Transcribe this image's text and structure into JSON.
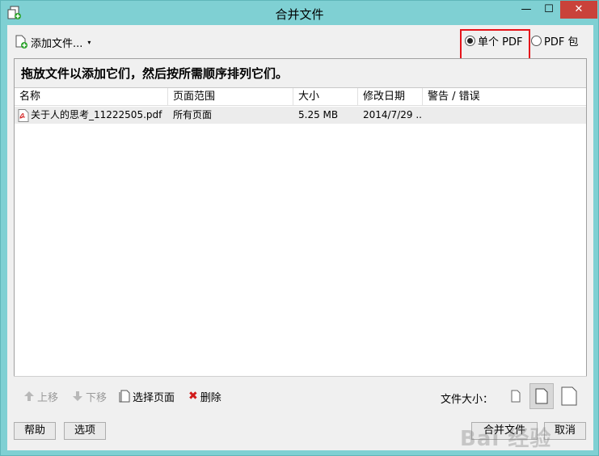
{
  "window": {
    "title": "合并文件",
    "minimize": "—",
    "maximize": "☐",
    "close": "✕"
  },
  "toolbar": {
    "add_files_label": "添加文件...",
    "add_files_caret": "▾",
    "radio_single_label": "单个 PDF",
    "radio_single_checked": true,
    "radio_package_label": "PDF 包",
    "radio_package_checked": false
  },
  "banner": {
    "text": "拖放文件以添加它们，然后按所需顺序排列它们。"
  },
  "table": {
    "columns": [
      "名称",
      "页面范围",
      "大小",
      "修改日期",
      "警告 / 错误"
    ],
    "rows": [
      {
        "name": "关于人的思考_11222505.pdf",
        "page_range": "所有页面",
        "size": "5.25 MB",
        "modified": "2014/7/29 ...",
        "warning": ""
      }
    ]
  },
  "bottom_toolbar": {
    "move_up_label": "上移",
    "move_down_label": "下移",
    "select_pages_label": "选择页面",
    "delete_label": "删除",
    "file_size_label": "文件大小：",
    "file_size_selected": "medium"
  },
  "footer": {
    "help_label": "帮助",
    "options_label": "选项",
    "combine_label": "合并文件",
    "cancel_label": "取消"
  },
  "watermark": {
    "text": "Bai 经验"
  },
  "colors": {
    "titlebar": "#7fd0d3",
    "close_button": "#c9423a",
    "highlight": "#e5141a",
    "selected_row": "#ececec"
  }
}
